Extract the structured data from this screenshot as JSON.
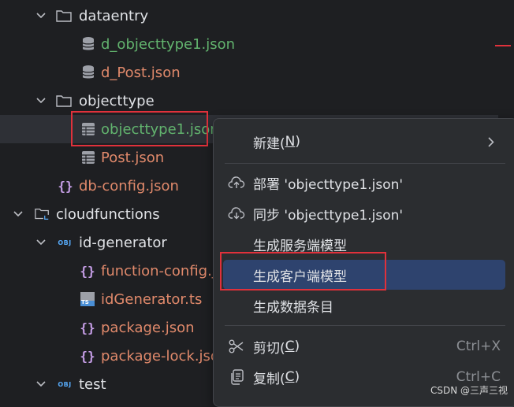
{
  "tree": {
    "items": [
      {
        "label": "dataentry",
        "kind": "folder",
        "expanded": true
      },
      {
        "label": "d_objecttype1.json",
        "kind": "db-file",
        "color": "#62b36e"
      },
      {
        "label": "d_Post.json",
        "kind": "db-file",
        "color": "#e0896b"
      },
      {
        "label": "objecttype",
        "kind": "folder",
        "expanded": true
      },
      {
        "label": "objecttype1.json",
        "kind": "table-file",
        "color": "#62b36e",
        "selected": true
      },
      {
        "label": "Post.json",
        "kind": "table-file",
        "color": "#e0896b"
      },
      {
        "label": "db-config.json",
        "kind": "json-file",
        "color": "#e0896b"
      },
      {
        "label": "cloudfunctions",
        "kind": "cloud-folder",
        "expanded": true
      },
      {
        "label": "id-generator",
        "kind": "obj-module",
        "expanded": true
      },
      {
        "label": "function-config.json",
        "kind": "json-file",
        "color": "#e0896b"
      },
      {
        "label": "idGenerator.ts",
        "kind": "ts-file",
        "color": "#e0896b"
      },
      {
        "label": "package.json",
        "kind": "json-file",
        "color": "#e0896b"
      },
      {
        "label": "package-lock.json",
        "kind": "json-file",
        "color": "#e0896b"
      },
      {
        "label": "test",
        "kind": "obj-module",
        "expanded": true
      }
    ],
    "obj_badge": "OBJ",
    "ts_badge": "TS"
  },
  "context_menu": {
    "new": {
      "label": "新建(",
      "mnemonic": "N",
      "close": ")"
    },
    "deploy": {
      "label": "部署 'objecttype1.json'",
      "icon": "cloud-upload-icon"
    },
    "sync": {
      "label": "同步 'objecttype1.json'",
      "icon": "cloud-download-icon"
    },
    "gen_server": {
      "label": "生成服务端模型"
    },
    "gen_client": {
      "label": "生成客户端模型"
    },
    "gen_data": {
      "label": "生成数据条目"
    },
    "cut": {
      "label": "剪切(",
      "mnemonic": "C",
      "close": ")",
      "shortcut": "Ctrl+X"
    },
    "copy": {
      "label": "复制(",
      "mnemonic": "C",
      "close": ")",
      "shortcut": "Ctrl+C"
    }
  },
  "watermark": "CSDN @三声三视",
  "colors": {
    "background": "#1e1f22",
    "menu_bg": "#2b2d30",
    "highlight": "#2e436e",
    "annotation_red": "#e0313b",
    "green_file": "#62b36e",
    "orange_file": "#e0896b"
  }
}
